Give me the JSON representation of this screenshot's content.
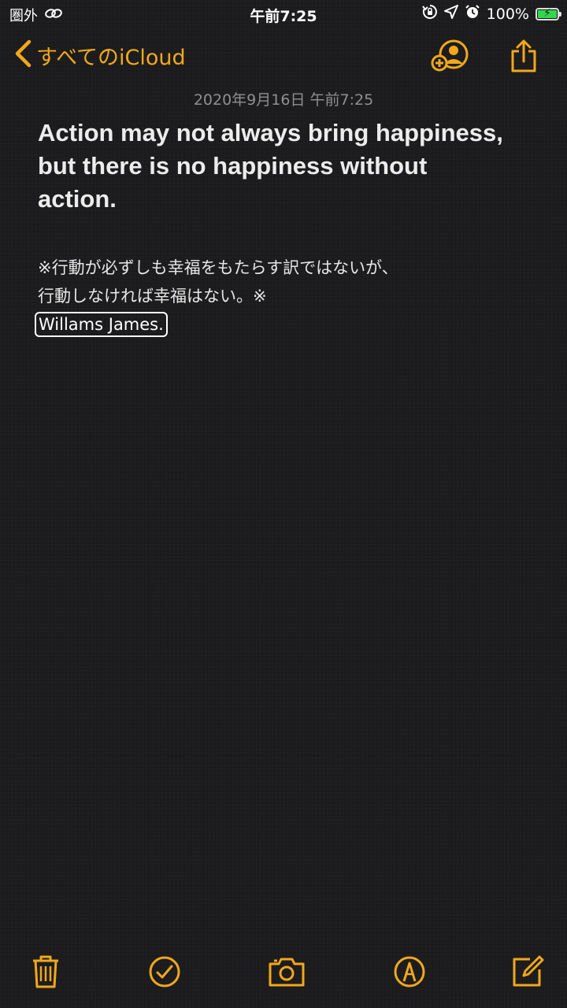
{
  "status_bar": {
    "carrier": "圏外",
    "time": "午前7:25",
    "battery_percent": "100%",
    "battery_level": 1.0,
    "icons": [
      "link-icon",
      "rotation-lock-icon",
      "location-icon",
      "alarm-icon",
      "battery-charging-icon"
    ]
  },
  "nav": {
    "back_label": "すべてのiCloud",
    "icons": [
      "chevron-left-icon",
      "add-person-icon",
      "share-icon"
    ]
  },
  "note": {
    "date": "2020年9月16日 午前7:25",
    "title_lines": [
      "Action may not always bring happiness,",
      "but there is no happiness without",
      "action."
    ],
    "jp_lines": [
      "※行動が必ずしも幸福をもたらす訳ではないが、",
      "行動しなければ幸福はない。※"
    ],
    "author": "Willams James."
  },
  "toolbar": {
    "icons": [
      "trash-icon",
      "checklist-icon",
      "camera-icon",
      "markup-pen-icon",
      "compose-icon"
    ]
  },
  "colors": {
    "accent": "#f1a81c",
    "background": "#1c1c1e",
    "text": "#e9e9e9",
    "secondary_text": "#8e8e93",
    "battery_fill": "#32d74b"
  }
}
